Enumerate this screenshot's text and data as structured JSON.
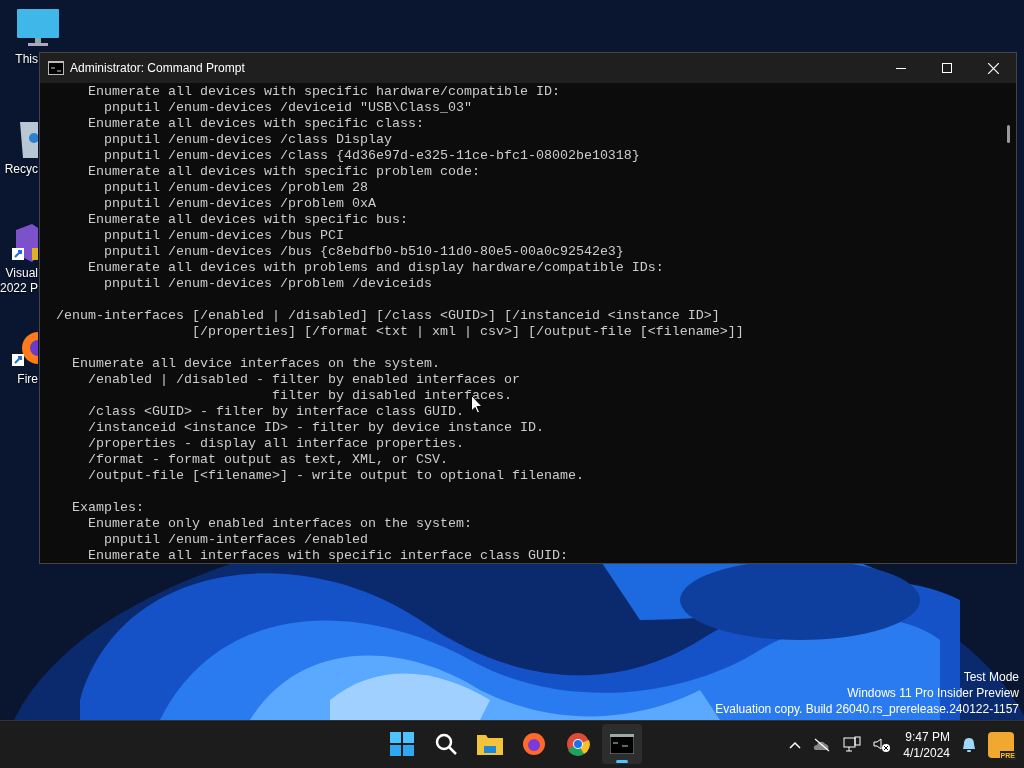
{
  "desktop_icons": [
    {
      "kind": "monitor",
      "label_lines": [
        "This"
      ]
    },
    {
      "kind": "recycle",
      "label_lines": [
        "Recyc"
      ]
    },
    {
      "kind": "vs",
      "label_lines": [
        "Visual",
        "2022 P"
      ]
    },
    {
      "kind": "firefox",
      "label_lines": [
        "Fire"
      ]
    }
  ],
  "window": {
    "title": "Administrator: Command Prompt",
    "blocks": [
      [
        "    Enumerate all devices with specific hardware/compatible ID:",
        "      pnputil /enum-devices /deviceid \"USB\\Class_03\"",
        "    Enumerate all devices with specific class:",
        "      pnputil /enum-devices /class Display",
        "      pnputil /enum-devices /class {4d36e97d-e325-11ce-bfc1-08002be10318}",
        "    Enumerate all devices with specific problem code:",
        "      pnputil /enum-devices /problem 28",
        "      pnputil /enum-devices /problem 0xA",
        "    Enumerate all devices with specific bus:",
        "      pnputil /enum-devices /bus PCI",
        "      pnputil /enum-devices /bus {c8ebdfb0-b510-11d0-80e5-00a0c92542e3}",
        "    Enumerate all devices with problems and display hardware/compatible IDs:",
        "      pnputil /enum-devices /problem /deviceids"
      ],
      [
        "/enum-interfaces [/enabled | /disabled] [/class <GUID>] [/instanceid <instance ID>]",
        "                 [/properties] [/format <txt | xml | csv>] [/output-file [<filename>]]"
      ],
      [
        "  Enumerate all device interfaces on the system.",
        "    /enabled | /disabled - filter by enabled interfaces or",
        "                           filter by disabled interfaces.",
        "    /class <GUID> - filter by interface class GUID.",
        "    /instanceid <instance ID> - filter by device instance ID.",
        "    /properties - display all interface properties.",
        "    /format - format output as text, XML, or CSV.",
        "    /output-file [<filename>] - write output to optional filename."
      ],
      [
        "  Examples:",
        "    Enumerate only enabled interfaces on the system:",
        "      pnputil /enum-interfaces /enabled",
        "    Enumerate all interfaces with specific interface class GUID:"
      ]
    ]
  },
  "watermark": [
    "Test Mode",
    "Windows 11 Pro Insider Preview",
    "Evaluation copy. Build 26040.rs_prerelease.240122-1157"
  ],
  "taskbar": {
    "apps": [
      {
        "kind": "start",
        "selected": false
      },
      {
        "kind": "search",
        "selected": false
      },
      {
        "kind": "explorer",
        "selected": false
      },
      {
        "kind": "firefox",
        "selected": false
      },
      {
        "kind": "chrome",
        "selected": false
      },
      {
        "kind": "terminal",
        "selected": true
      }
    ],
    "time": "9:47 PM",
    "date": "4/1/2024",
    "copilot_badge": "PRE"
  }
}
